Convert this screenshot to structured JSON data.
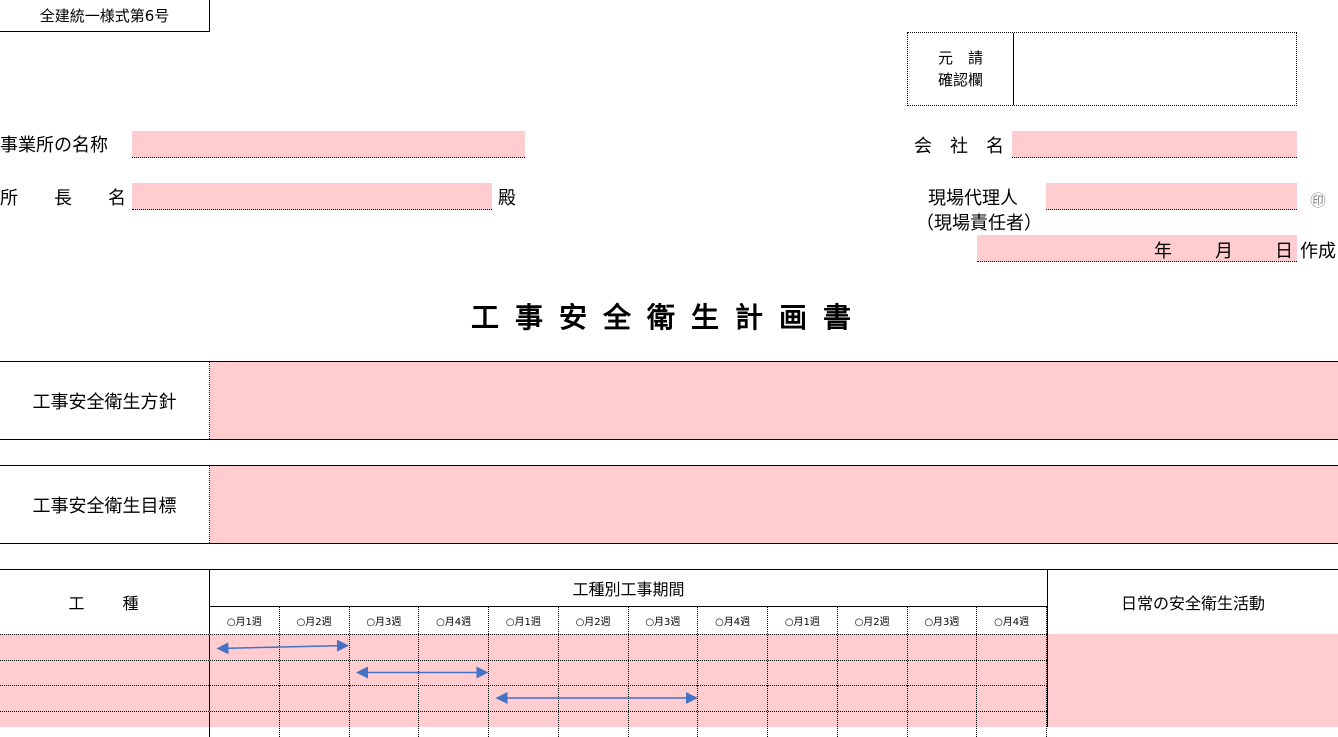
{
  "form_number": "全建統一様式第6号",
  "confirmation": {
    "label_line1": "元　請",
    "label_line2": "確認欄",
    "value": ""
  },
  "office_name": {
    "label": "事業所の名称",
    "value": ""
  },
  "director": {
    "label": "所　　長　　名",
    "value": "",
    "suffix": "殿"
  },
  "company_name": {
    "label": "会　社　名",
    "value": ""
  },
  "site_agent": {
    "label": "現場代理人",
    "sub_label": "（現場責任者）",
    "value": "",
    "seal": "㊞"
  },
  "date": {
    "year_label": "年",
    "month_label": "月",
    "day_label": "日",
    "suffix": "作成"
  },
  "title": "工事安全衛生計画書",
  "policy": {
    "label": "工事安全衛生方針",
    "value": ""
  },
  "goal": {
    "label": "工事安全衛生目標",
    "value": ""
  },
  "schedule": {
    "work_type_header": "工　　種",
    "period_header": "工種別工事期間",
    "daily_activity_header": "日常の安全衛生活動",
    "weeks": [
      "○月1週",
      "○月2週",
      "○月3週",
      "○月4週",
      "○月1週",
      "○月2週",
      "○月3週",
      "○月4週",
      "○月1週",
      "○月2週",
      "○月3週",
      "○月4週"
    ],
    "arrow_color": "#4472c4",
    "pink_color": "#ffcccf"
  }
}
